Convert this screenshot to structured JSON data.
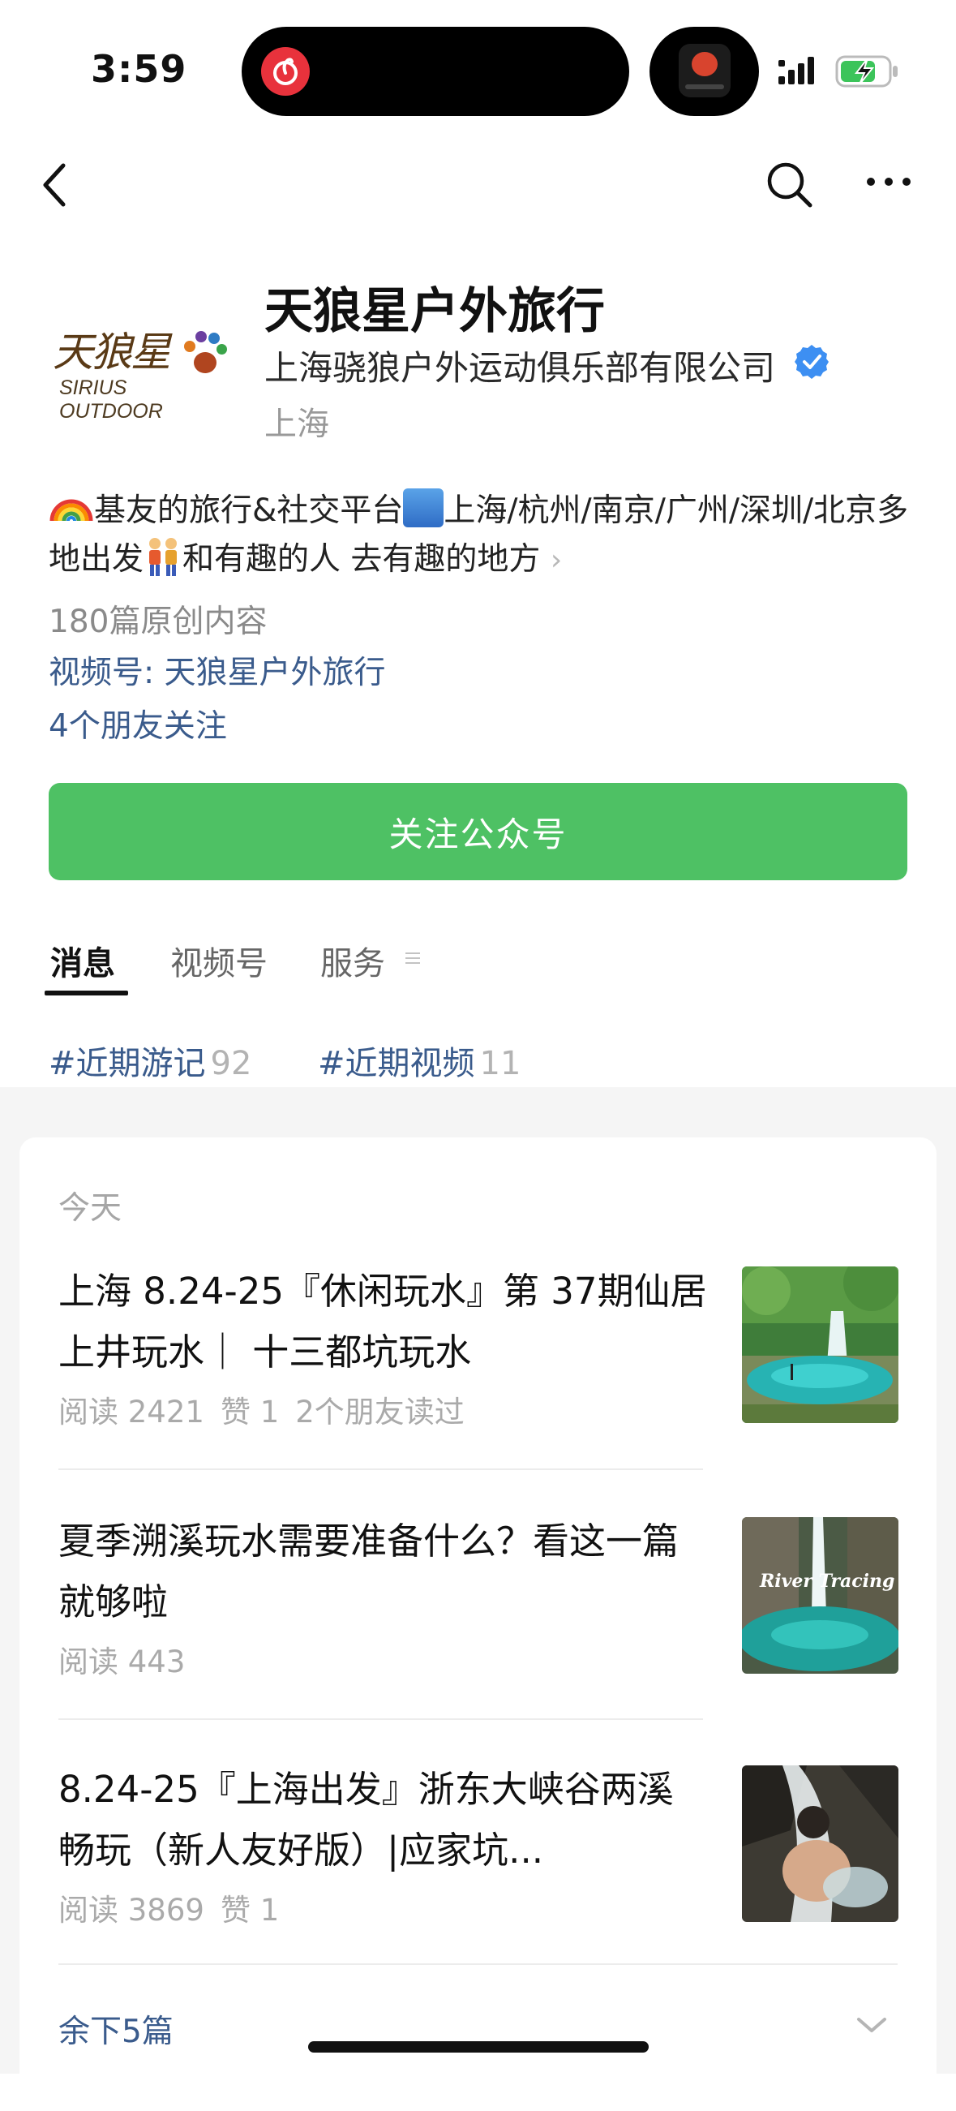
{
  "status_bar": {
    "time": "3:59"
  },
  "account": {
    "logo_script": "天狼星",
    "logo_sub": "SIRIUS OUTDOOR",
    "name": "天狼星户外旅行",
    "company": "上海骁狼户外运动俱乐部有限公司",
    "location": "上海",
    "bio_part1": "基友的旅行&社交平台",
    "bio_part2": "上海/杭州/南京/广州/深圳/北京多地出发",
    "bio_part3": "和有趣的人 去有趣的地方",
    "original_count": "180篇原创内容",
    "video_channel": "视频号: 天狼星户外旅行",
    "friends_following": "4个朋友关注",
    "follow_button": "关注公众号",
    "accent_color": "#4ec164",
    "link_color": "#3a5b8c"
  },
  "tabs": [
    {
      "label": "消息",
      "active": true
    },
    {
      "label": "视频号",
      "active": false
    },
    {
      "label": "服务",
      "active": false
    }
  ],
  "tags": [
    {
      "label": "#近期游记",
      "count": "92"
    },
    {
      "label": "#近期视频",
      "count": "11"
    }
  ],
  "feed": {
    "section_label": "今天",
    "articles": [
      {
        "title": "上海 8.24-25『休闲玩水』第 37期仙居上井玩水｜ 十三都坑玩水",
        "reads": "阅读 2421",
        "likes": "赞 1",
        "friends": "2个朋友读过",
        "thumb_icon": "waterfall-photo"
      },
      {
        "title": "夏季溯溪玩水需要准备什么？看这一篇就够啦",
        "reads": "阅读 443",
        "thumb_text": "River Tracing",
        "thumb_icon": "river-tracing-photo"
      },
      {
        "title": "8.24-25『上海出发』浙东大峡谷两溪畅玩（新人友好版）|应家坑...",
        "reads": "阅读 3869",
        "likes": "赞 1",
        "thumb_icon": "person-in-stream-photo"
      }
    ],
    "remaining": "余下5篇"
  }
}
